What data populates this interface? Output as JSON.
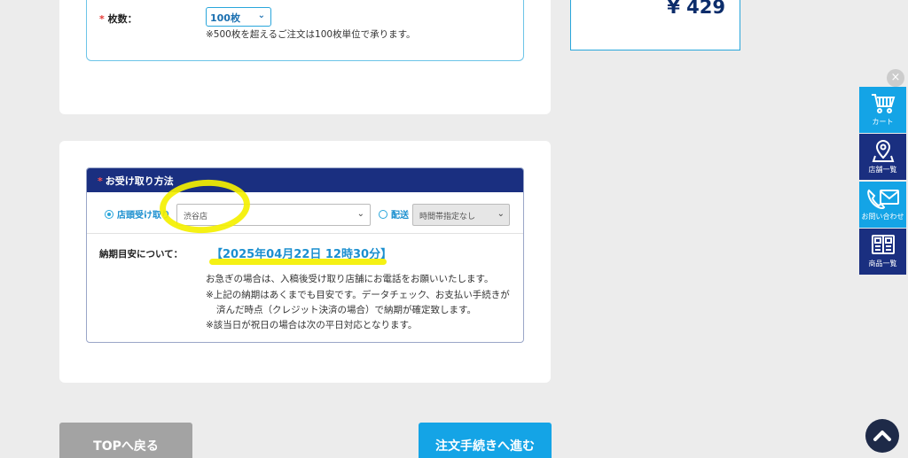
{
  "quantity": {
    "label": "枚数：",
    "required_mark": "*",
    "selected": "100枚",
    "note": "※500枚を超えるご注文は100枚単位で承ります。"
  },
  "total": {
    "price": "¥ 429"
  },
  "pickup": {
    "required_mark": "*",
    "title": "お受け取り方法",
    "store_option_label": "店頭受け取り",
    "store_selected": "渋谷店",
    "shipping_option_label": "配送",
    "time_selected": "時間帯指定なし",
    "eta_label": "納期目安について：",
    "eta_value": "【2025年04月22日 12時30分】",
    "notes": [
      "お急ぎの場合は、入稿後受け取り店舗にお電話をお願いいたします。",
      "※上記の納期はあくまでも目安です。データチェック、お支払い手続きが",
      "済んだ時点（クレジット決済の場合）で納期が確定致します。",
      "※該当日が祝日の場合は次の平日対応となります。"
    ]
  },
  "buttons": {
    "top": "TOPへ戻る",
    "next": "注文手続きへ進む"
  },
  "side_menu": {
    "close": "×",
    "items": [
      {
        "label": "カート",
        "icon": "cart-icon"
      },
      {
        "label": "店舗一覧",
        "icon": "map-pin-icon"
      },
      {
        "label": "お問い合わせ",
        "icon": "phone-mail-icon"
      },
      {
        "label": "商品一覧",
        "icon": "catalog-icon"
      }
    ]
  },
  "colors": {
    "accent": "#14a4e6",
    "navy": "#1a2f80",
    "highlight": "#f4f000"
  }
}
